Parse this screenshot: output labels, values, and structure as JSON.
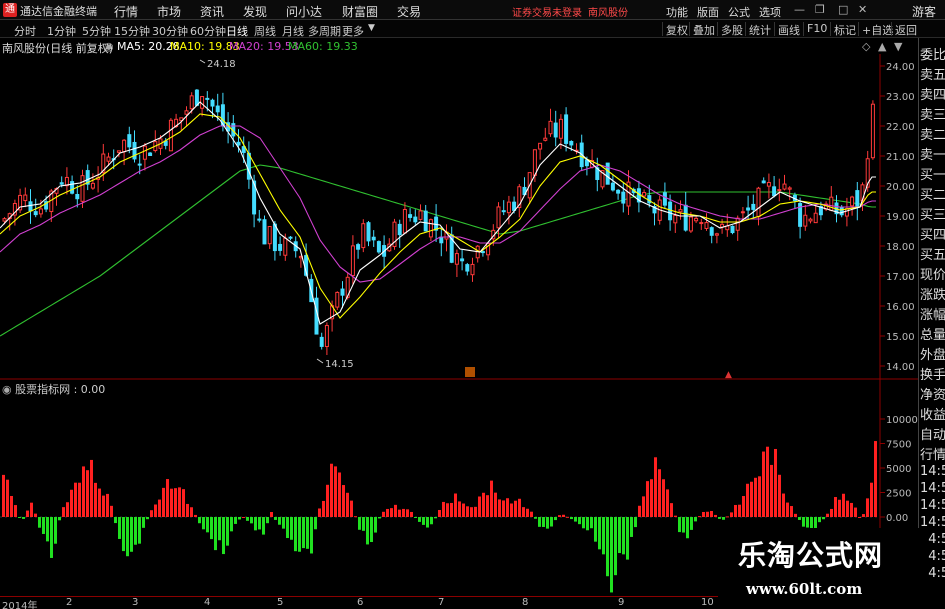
{
  "app": {
    "logo_glyph": "通",
    "title": "通达信金融终端"
  },
  "menu": [
    "行情",
    "市场",
    "资讯",
    "发现",
    "问小达",
    "财富圈",
    "交易"
  ],
  "top_status": {
    "warning": "证券交易未登录",
    "stock": "南风股份"
  },
  "right_menu": [
    "功能",
    "版面",
    "公式",
    "选项"
  ],
  "guest": "游客",
  "periods": [
    "分时",
    "1分钟",
    "5分钟",
    "15分钟",
    "30分钟",
    "60分钟",
    "日线",
    "周线",
    "月线",
    "多周期",
    "更多"
  ],
  "active_period": "日线",
  "toolbar": [
    "复权",
    "叠加",
    "多股",
    "统计",
    "画线",
    "F10",
    "标记",
    "+自选",
    "返回"
  ],
  "main_header": {
    "title": "南风股份(日线 前复权)",
    "ma5": "MA5: 20.28",
    "ma10": "MA10: 19.83",
    "ma20": "MA20: 19.53",
    "ma60": "MA60: 19.33"
  },
  "indicator_header": "股票指标网 : 0.00",
  "annotations": {
    "high": "24.18",
    "low": "14.15"
  },
  "right_column": [
    "委比",
    "卖五",
    "卖四",
    "卖三",
    "卖二",
    "卖一",
    "买一",
    "买二",
    "买三",
    "买四",
    "买五",
    "现价",
    "涨跌",
    "涨幅",
    "总量",
    "外盘",
    "换手",
    "净资",
    "收益",
    "自动",
    "行情",
    "14:5",
    "14:5",
    "14:5",
    "14:5",
    "14:5",
    "14:5",
    "14:5"
  ],
  "dates": [
    "2014年",
    "2",
    "3",
    "4",
    "5",
    "6",
    "7",
    "8",
    "9",
    "10"
  ],
  "watermark": {
    "title": "乐淘公式网",
    "url": "www.60lt.com"
  },
  "colors": {
    "up": "#ff3a3a",
    "down": "#44ddff",
    "ma5": "#ffffff",
    "ma10": "#ffff00",
    "ma20": "#d040d0",
    "ma60": "#30c030",
    "ind_up": "#ff2020",
    "ind_down": "#20e020"
  },
  "chart_data": [
    {
      "type": "candlestick",
      "title": "南风股份(日线 前复权)",
      "price_axis": {
        "ticks": [
          24.0,
          23.0,
          22.0,
          21.0,
          20.0,
          19.0,
          18.0,
          17.0,
          16.0,
          15.0,
          14.0
        ]
      },
      "anchors_x": [
        0,
        20,
        40,
        60,
        80,
        100,
        120,
        140,
        160,
        180,
        200,
        220,
        240,
        260,
        280,
        300,
        320,
        340,
        360,
        380,
        400,
        420,
        440,
        460,
        480,
        500,
        520,
        540,
        560,
        580,
        600,
        620,
        640,
        660,
        680,
        700,
        720,
        740,
        760,
        780,
        800,
        820,
        840,
        860,
        870
      ],
      "close_path": [
        18.8,
        19.6,
        19.3,
        20.3,
        19.9,
        20.6,
        21.5,
        21.1,
        21.6,
        22.3,
        23.3,
        22.1,
        21.3,
        18.4,
        18.0,
        17.8,
        14.6,
        16.6,
        18.4,
        17.6,
        18.9,
        19.1,
        18.4,
        17.4,
        18.1,
        19.1,
        19.8,
        21.6,
        21.9,
        21.1,
        20.4,
        19.9,
        19.4,
        19.1,
        18.9,
        19.1,
        18.4,
        18.9,
        19.6,
        20.3,
        18.9,
        19.3,
        19.1,
        19.6,
        22.4
      ],
      "ma5_path": [
        18.6,
        19.3,
        19.4,
        20.0,
        20.1,
        20.4,
        21.1,
        21.3,
        21.6,
        22.1,
        22.8,
        22.2,
        21.2,
        19.6,
        18.4,
        17.9,
        15.4,
        15.8,
        17.2,
        17.7,
        18.3,
        18.8,
        18.7,
        17.9,
        17.8,
        18.6,
        19.4,
        20.7,
        21.4,
        21.1,
        20.5,
        20.0,
        19.5,
        19.2,
        19.0,
        19.0,
        18.6,
        18.8,
        19.3,
        19.8,
        19.5,
        19.3,
        19.1,
        19.3,
        20.3
      ],
      "ma10_path": [
        18.4,
        19.0,
        19.3,
        19.7,
        20.0,
        20.3,
        20.8,
        21.1,
        21.4,
        21.8,
        22.4,
        22.3,
        21.6,
        20.4,
        19.2,
        18.3,
        16.6,
        15.6,
        16.3,
        17.1,
        17.8,
        18.4,
        18.6,
        18.2,
        17.8,
        18.3,
        18.9,
        20.0,
        20.8,
        21.0,
        20.7,
        20.2,
        19.7,
        19.3,
        19.1,
        19.0,
        18.8,
        18.8,
        19.0,
        19.4,
        19.5,
        19.4,
        19.2,
        19.3,
        19.8
      ],
      "ma20_path": [
        17.8,
        18.4,
        18.7,
        19.1,
        19.4,
        19.7,
        20.1,
        20.5,
        20.8,
        21.2,
        21.7,
        22.0,
        22.0,
        21.6,
        20.6,
        19.6,
        18.2,
        17.3,
        16.8,
        16.9,
        17.4,
        17.9,
        18.3,
        18.3,
        18.1,
        18.1,
        18.5,
        19.2,
        19.9,
        20.5,
        20.7,
        20.5,
        20.1,
        19.7,
        19.4,
        19.2,
        19.0,
        18.9,
        18.9,
        19.1,
        19.3,
        19.4,
        19.3,
        19.3,
        19.5
      ],
      "ma60_path": [
        15.0,
        15.4,
        15.8,
        16.2,
        16.6,
        17.0,
        17.5,
        18.0,
        18.5,
        19.0,
        19.5,
        20.0,
        20.5,
        20.7,
        20.6,
        20.4,
        20.2,
        20.0,
        19.8,
        19.6,
        19.4,
        19.2,
        19.0,
        18.8,
        18.6,
        18.4,
        18.5,
        18.7,
        18.9,
        19.1,
        19.3,
        19.5,
        19.7,
        19.8,
        19.8,
        19.8,
        19.8,
        19.8,
        19.8,
        19.8,
        19.7,
        19.6,
        19.5,
        19.4,
        19.3
      ]
    },
    {
      "type": "bar",
      "title": "股票指标网",
      "y_axis": {
        "ticks": [
          10000,
          7500,
          5000,
          2500,
          0
        ]
      },
      "anchors_x": [
        0,
        10,
        20,
        30,
        40,
        50,
        60,
        70,
        80,
        90,
        100,
        110,
        120,
        130,
        140,
        150,
        160,
        170,
        180,
        190,
        200,
        210,
        220,
        230,
        240,
        250,
        260,
        270,
        280,
        290,
        300,
        310,
        320,
        330,
        340,
        350,
        360,
        370,
        380,
        390,
        400,
        410,
        420,
        430,
        440,
        450,
        460,
        470,
        480,
        490,
        500,
        510,
        520,
        530,
        540,
        550,
        560,
        570,
        580,
        590,
        600,
        610,
        620,
        630,
        640,
        650,
        660,
        670,
        680,
        690,
        700,
        710,
        720,
        730,
        740,
        750,
        760,
        770,
        780,
        790,
        800,
        810,
        820,
        830,
        840,
        850,
        860,
        870,
        878
      ],
      "value_path": [
        5600,
        3000,
        -800,
        1600,
        -1600,
        -5000,
        700,
        2800,
        4500,
        6500,
        4200,
        1000,
        -3500,
        -4000,
        -2000,
        1000,
        2500,
        4000,
        3000,
        1000,
        -1000,
        -2500,
        -4000,
        -2000,
        200,
        -800,
        -2200,
        500,
        -1500,
        -3500,
        -5500,
        -4000,
        2000,
        5000,
        4000,
        1500,
        -2000,
        -3000,
        500,
        1500,
        1000,
        500,
        -800,
        -1200,
        1500,
        2000,
        2500,
        1000,
        2200,
        4500,
        2500,
        1500,
        1800,
        500,
        -1500,
        -1000,
        500,
        -300,
        -1000,
        -1500,
        -3500,
        -7000,
        -5000,
        -3000,
        2000,
        6000,
        4500,
        2000,
        -2500,
        -1500,
        500,
        800,
        -500,
        500,
        2000,
        4500,
        6000,
        8500,
        3000,
        1500,
        -1000,
        -2000,
        -500,
        1000,
        3000,
        2000,
        -500,
        3500,
        12000
      ]
    }
  ]
}
